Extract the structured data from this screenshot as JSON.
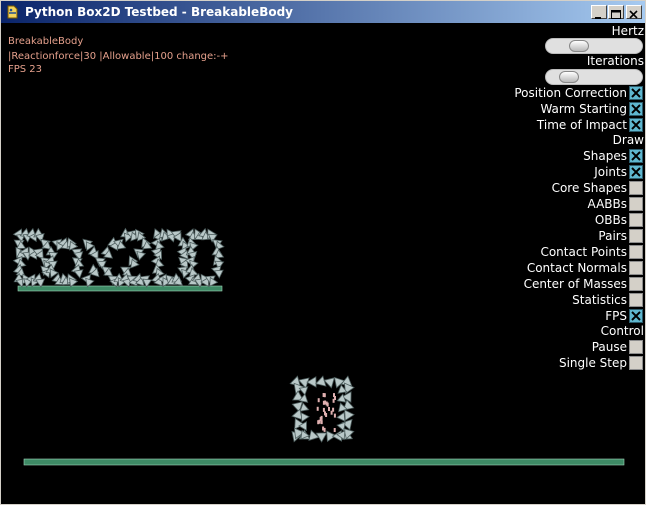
{
  "window": {
    "title": "Python Box2D Testbed - BreakableBody"
  },
  "info": {
    "test_name": "BreakableBody",
    "reaction_line": "|Reactionforce|30 |Allowable|100 change:-+",
    "fps_line": "FPS 23"
  },
  "panel": {
    "hertz_label": "Hertz",
    "hertz_level": 0.3,
    "iterations_label": "Iterations",
    "iterations_level": 0.17,
    "draw_label": "Draw",
    "control_label": "Control",
    "toggles_top": [
      {
        "label": "Position Correction",
        "checked": true
      },
      {
        "label": "Warm Starting",
        "checked": true
      },
      {
        "label": "Time of Impact",
        "checked": true
      }
    ],
    "draw_toggles": [
      {
        "label": "Shapes",
        "checked": true
      },
      {
        "label": "Joints",
        "checked": true
      },
      {
        "label": "Core Shapes",
        "checked": false
      },
      {
        "label": "AABBs",
        "checked": false
      },
      {
        "label": "OBBs",
        "checked": false
      },
      {
        "label": "Pairs",
        "checked": false
      },
      {
        "label": "Contact Points",
        "checked": false
      },
      {
        "label": "Contact Normals",
        "checked": false
      },
      {
        "label": "Center of Masses",
        "checked": false
      },
      {
        "label": "Statistics",
        "checked": false
      },
      {
        "label": "FPS",
        "checked": true
      }
    ],
    "control_toggles": [
      {
        "label": "Pause",
        "checked": false
      },
      {
        "label": "Single Step",
        "checked": false
      }
    ]
  },
  "colors": {
    "info_text": "#e5a08c",
    "shape_fill": "#b9c8c8",
    "shape_edge": "#4f5f5f",
    "ground": "#3e8a65",
    "particle": "#e0b0b0",
    "checkbox_on": "#5fb7cf"
  }
}
